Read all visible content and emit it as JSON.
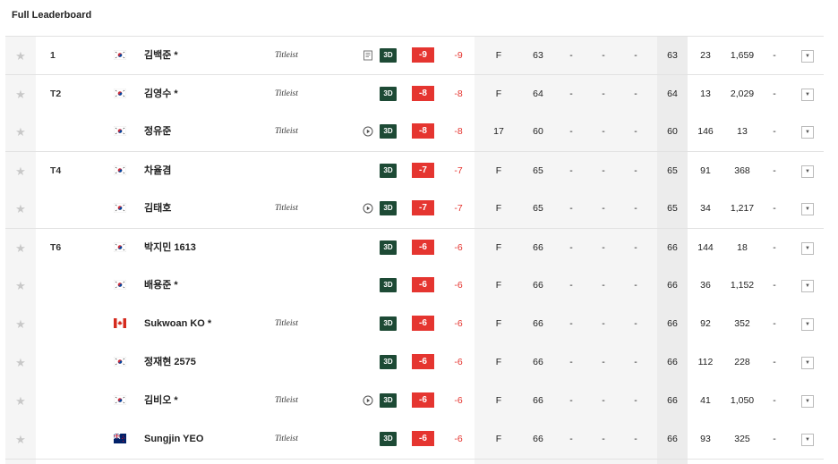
{
  "title": "Full Leaderboard",
  "icons": {
    "star": "★",
    "dropdown": "▼",
    "scorecard": "scorecard-icon",
    "video": "play-circle-icon"
  },
  "badge_3d": "3D",
  "colors": {
    "score_red": "#e53530",
    "badge_green": "#1d4a35"
  },
  "brand_label": "Titleist",
  "players": [
    {
      "pos": "1",
      "flag": "KR",
      "name": "김백준 *",
      "brand": true,
      "scorecard": true,
      "video": false,
      "score": "-9",
      "today": "-9",
      "thru": "F",
      "r1": "63",
      "r2": "-",
      "r3": "-",
      "r4": "-",
      "total": "63",
      "pts1": "23",
      "pts2": "1,659",
      "extra": "-"
    },
    {
      "pos": "T2",
      "flag": "KR",
      "name": "김영수 *",
      "brand": true,
      "scorecard": false,
      "video": false,
      "score": "-8",
      "today": "-8",
      "thru": "F",
      "r1": "64",
      "r2": "-",
      "r3": "-",
      "r4": "-",
      "total": "64",
      "pts1": "13",
      "pts2": "2,029",
      "extra": "-"
    },
    {
      "pos": "",
      "flag": "KR",
      "name": "정유준",
      "brand": true,
      "scorecard": false,
      "video": true,
      "score": "-8",
      "today": "-8",
      "thru": "17",
      "r1": "60",
      "r2": "-",
      "r3": "-",
      "r4": "-",
      "total": "60",
      "pts1": "146",
      "pts2": "13",
      "extra": "-"
    },
    {
      "pos": "T4",
      "flag": "KR",
      "name": "차율겸",
      "brand": false,
      "scorecard": false,
      "video": false,
      "score": "-7",
      "today": "-7",
      "thru": "F",
      "r1": "65",
      "r2": "-",
      "r3": "-",
      "r4": "-",
      "total": "65",
      "pts1": "91",
      "pts2": "368",
      "extra": "-"
    },
    {
      "pos": "",
      "flag": "KR",
      "name": "김태호",
      "brand": true,
      "scorecard": false,
      "video": true,
      "score": "-7",
      "today": "-7",
      "thru": "F",
      "r1": "65",
      "r2": "-",
      "r3": "-",
      "r4": "-",
      "total": "65",
      "pts1": "34",
      "pts2": "1,217",
      "extra": "-"
    },
    {
      "pos": "T6",
      "flag": "KR",
      "name": "박지민 1613",
      "brand": false,
      "scorecard": false,
      "video": false,
      "score": "-6",
      "today": "-6",
      "thru": "F",
      "r1": "66",
      "r2": "-",
      "r3": "-",
      "r4": "-",
      "total": "66",
      "pts1": "144",
      "pts2": "18",
      "extra": "-"
    },
    {
      "pos": "",
      "flag": "KR",
      "name": "배용준 *",
      "brand": false,
      "scorecard": false,
      "video": false,
      "score": "-6",
      "today": "-6",
      "thru": "F",
      "r1": "66",
      "r2": "-",
      "r3": "-",
      "r4": "-",
      "total": "66",
      "pts1": "36",
      "pts2": "1,152",
      "extra": "-"
    },
    {
      "pos": "",
      "flag": "CA",
      "name": "Sukwoan KO *",
      "brand": true,
      "scorecard": false,
      "video": false,
      "score": "-6",
      "today": "-6",
      "thru": "F",
      "r1": "66",
      "r2": "-",
      "r3": "-",
      "r4": "-",
      "total": "66",
      "pts1": "92",
      "pts2": "352",
      "extra": "-"
    },
    {
      "pos": "",
      "flag": "KR",
      "name": "정재현 2575",
      "brand": false,
      "scorecard": false,
      "video": false,
      "score": "-6",
      "today": "-6",
      "thru": "F",
      "r1": "66",
      "r2": "-",
      "r3": "-",
      "r4": "-",
      "total": "66",
      "pts1": "112",
      "pts2": "228",
      "extra": "-"
    },
    {
      "pos": "",
      "flag": "KR",
      "name": "김비오 *",
      "brand": true,
      "scorecard": false,
      "video": true,
      "score": "-6",
      "today": "-6",
      "thru": "F",
      "r1": "66",
      "r2": "-",
      "r3": "-",
      "r4": "-",
      "total": "66",
      "pts1": "41",
      "pts2": "1,050",
      "extra": "-"
    },
    {
      "pos": "",
      "flag": "NZ",
      "name": "Sungjin YEO",
      "brand": true,
      "scorecard": false,
      "video": false,
      "score": "-6",
      "today": "-6",
      "thru": "F",
      "r1": "66",
      "r2": "-",
      "r3": "-",
      "r4": "-",
      "total": "66",
      "pts1": "93",
      "pts2": "325",
      "extra": "-"
    }
  ]
}
